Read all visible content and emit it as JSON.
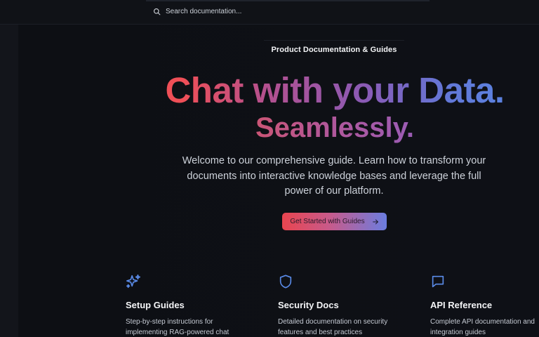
{
  "search": {
    "placeholder": "Search documentation..."
  },
  "hero": {
    "badge": "Product Documentation & Guides",
    "headline": "Chat with your Data.",
    "headline_sub": "Seamlessly.",
    "intro": "Welcome to our comprehensive guide. Learn how to transform your documents into interactive knowledge bases and leverage the full power of our platform.",
    "cta_label": "Get Started with Guides"
  },
  "features": [
    {
      "icon": "sparkles-icon",
      "title": "Setup Guides",
      "description": "Step-by-step instructions for implementing RAG-powered chat"
    },
    {
      "icon": "shield-icon",
      "title": "Security Docs",
      "description": "Detailed documentation on security features and best practices"
    },
    {
      "icon": "chat-bubble-icon",
      "title": "API Reference",
      "description": "Complete API documentation and integration guides"
    }
  ],
  "colors": {
    "accent_red": "#ee4d56",
    "accent_purple": "#8a5ab5",
    "accent_blue": "#5b82e0",
    "icon_blue": "#5a8be8",
    "background": "#0f1117"
  }
}
